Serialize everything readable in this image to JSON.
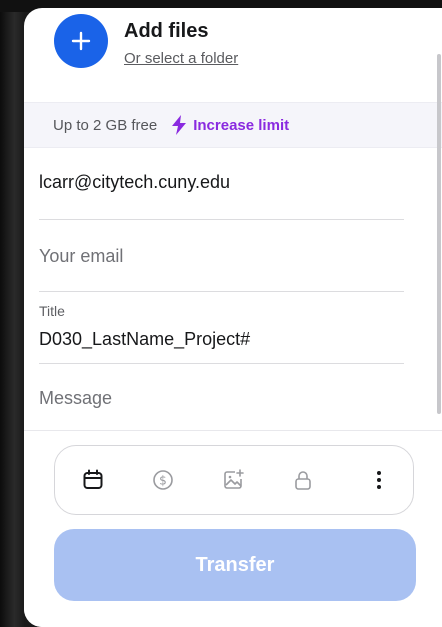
{
  "header": {
    "title": "Add files",
    "subtitle": "Or select a folder"
  },
  "limit": {
    "text": "Up to 2 GB free",
    "link": "Increase limit",
    "link_color": "#8a2ae0"
  },
  "form": {
    "to_email": "lcarr@citytech.cuny.edu",
    "your_email_placeholder": "Your email",
    "title_label": "Title",
    "title_value": "D030_LastName_Project#",
    "message_placeholder": "Message"
  },
  "toolbar": {
    "icons": [
      "calendar-icon",
      "dollar-icon",
      "image-sparkle-icon",
      "lock-icon",
      "more-vertical-icon"
    ]
  },
  "actions": {
    "transfer_label": "Transfer",
    "transfer_color": "#a9c1f2"
  },
  "colors": {
    "accent": "#1a63e8"
  }
}
